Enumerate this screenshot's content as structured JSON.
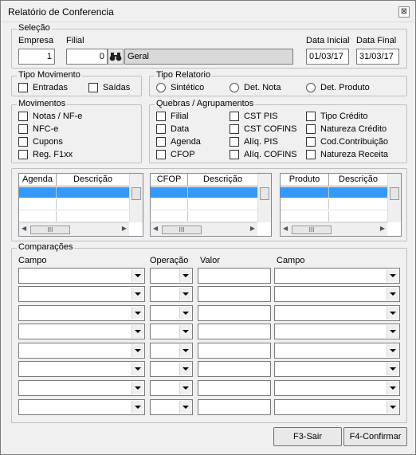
{
  "window": {
    "title": "Relatório de Conferencia",
    "close_glyph": "⊠"
  },
  "selecao": {
    "legend": "Seleção",
    "empresa_label": "Empresa",
    "empresa_value": "1",
    "filial_label": "Filial",
    "filial_value": "0",
    "filial_name": "Geral",
    "data_inicial_label": "Data Inicial",
    "data_inicial_value": "01/03/17",
    "data_final_label": "Data Final",
    "data_final_value": "31/03/17"
  },
  "tipo_movimento": {
    "legend": "Tipo Movimento",
    "entradas": "Entradas",
    "saidas": "Saídas"
  },
  "tipo_relatorio": {
    "legend": "Tipo Relatorio",
    "sintetico": "Sintético",
    "det_nota": "Det. Nota",
    "det_produto": "Det. Produto"
  },
  "movimentos": {
    "legend": "Movimentos",
    "items": [
      "Notas / NF-e",
      "NFC-e",
      "Cupons",
      "Reg. F1xx"
    ]
  },
  "quebras": {
    "legend": "Quebras / Agrupamentos",
    "col1": [
      "Filial",
      "Data",
      "Agenda",
      "CFOP"
    ],
    "col2": [
      "CST PIS",
      "CST COFINS",
      "Alíq. PIS",
      "Alíq. COFINS"
    ],
    "col3": [
      "Tipo Crédito",
      "Natureza Crédito",
      "Cod.Contribuição",
      "Natureza Receita"
    ]
  },
  "grids": [
    {
      "col1": "Agenda",
      "col2": "Descrição"
    },
    {
      "col1": "CFOP",
      "col2": "Descrição"
    },
    {
      "col1": "Produto",
      "col2": "Descrição"
    }
  ],
  "scroll_thumb_glyph": "III",
  "comparacoes": {
    "legend": "Comparações",
    "campo_label": "Campo",
    "operacao_label": "Operação",
    "valor_label": "Valor",
    "campo2_label": "Campo"
  },
  "buttons": {
    "sair": "F3-Sair",
    "confirmar": "F4-Confirmar"
  }
}
